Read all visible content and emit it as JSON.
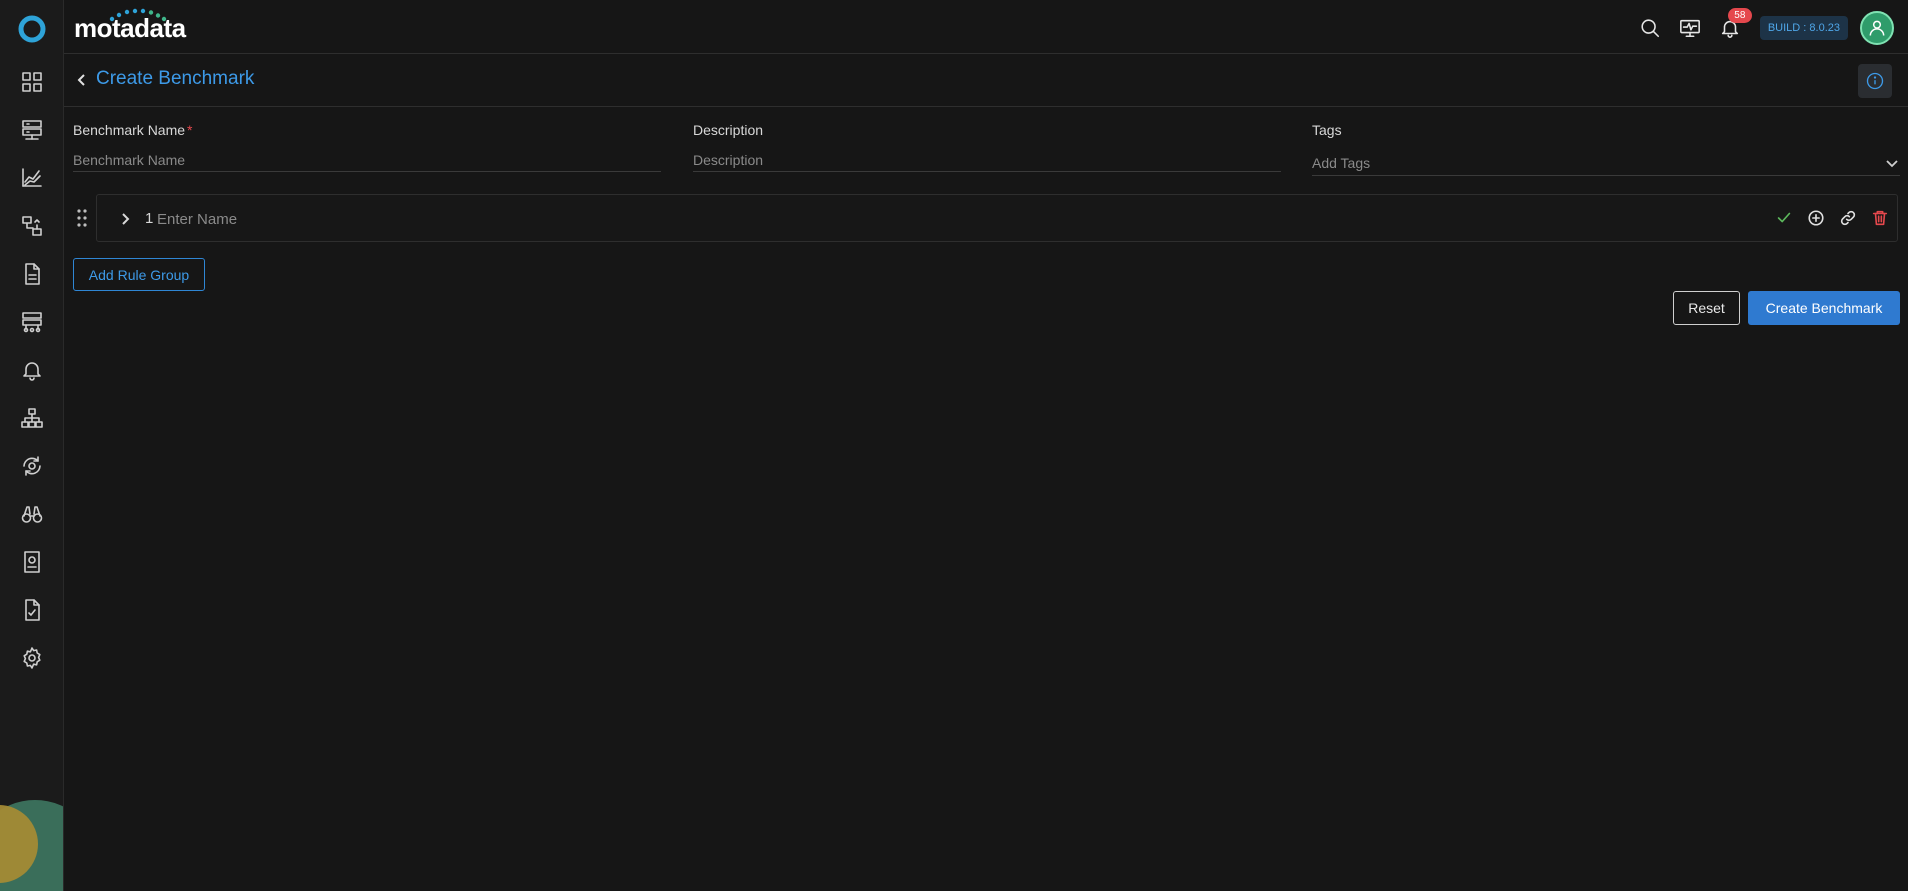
{
  "brand": {
    "name": "motadata"
  },
  "topbar": {
    "notification_count": "58",
    "build_label": "BUILD : 8.0.23"
  },
  "sidebar": {
    "items": [
      {
        "icon": "dashboard-grid-icon"
      },
      {
        "icon": "server-icon"
      },
      {
        "icon": "metric-chart-icon"
      },
      {
        "icon": "topology-flow-icon"
      },
      {
        "icon": "document-icon"
      },
      {
        "icon": "network-devices-icon"
      },
      {
        "icon": "bell-icon"
      },
      {
        "icon": "hierarchy-icon"
      },
      {
        "icon": "sync-gear-icon"
      },
      {
        "icon": "binoculars-icon"
      },
      {
        "icon": "report-icon"
      },
      {
        "icon": "compliance-checklist-icon"
      },
      {
        "icon": "settings-gear-icon"
      }
    ]
  },
  "page": {
    "title": "Create Benchmark"
  },
  "form": {
    "benchmark_name_label": "Benchmark Name",
    "benchmark_name_required": "*",
    "benchmark_name_placeholder": "Benchmark Name",
    "benchmark_name_value": "",
    "description_label": "Description",
    "description_placeholder": "Description",
    "description_value": "",
    "tags_label": "Tags",
    "tags_placeholder": "Add Tags"
  },
  "rule_group": {
    "index": "1",
    "name_placeholder": "Enter Name",
    "name_value": ""
  },
  "actions": {
    "add_rule_group": "Add Rule Group",
    "reset": "Reset",
    "create": "Create Benchmark"
  },
  "colors": {
    "accent": "#3d9ae8",
    "primary_button": "#2f7ad0",
    "danger": "#e5484d",
    "success": "#5cb85c"
  }
}
